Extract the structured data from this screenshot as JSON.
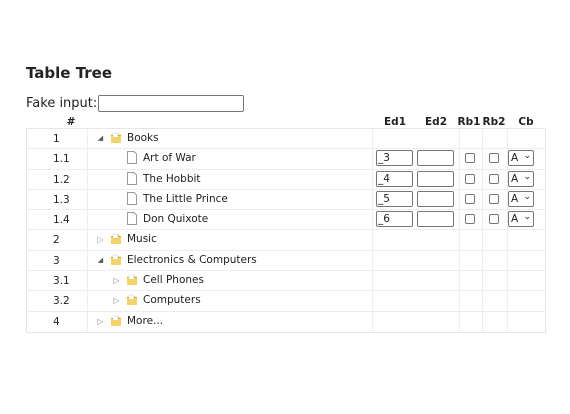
{
  "page": {
    "title": "Table Tree",
    "fake_input_label": "Fake input:",
    "fake_input_value": ""
  },
  "columns": {
    "num": "#",
    "ed1": "Ed1",
    "ed2": "Ed2",
    "rb1": "Rb1",
    "rb2": "Rb2",
    "cb": "Cb"
  },
  "rows": [
    {
      "num": "1",
      "title": "Books",
      "kind": "folder",
      "state": "expanded",
      "level": 0
    },
    {
      "num": "1.1",
      "title": "Art of War",
      "kind": "doc",
      "level": 1,
      "ed1": "_3",
      "ed2": "",
      "cb": "A"
    },
    {
      "num": "1.2",
      "title": "The Hobbit",
      "kind": "doc",
      "level": 1,
      "ed1": "_4",
      "ed2": "",
      "cb": "A"
    },
    {
      "num": "1.3",
      "title": "The Little Prince",
      "kind": "doc",
      "level": 1,
      "ed1": "_5",
      "ed2": "",
      "cb": "A"
    },
    {
      "num": "1.4",
      "title": "Don Quixote",
      "kind": "doc",
      "level": 1,
      "ed1": "_6",
      "ed2": "",
      "cb": "A"
    },
    {
      "num": "2",
      "title": "Music",
      "kind": "folder",
      "state": "collapsed",
      "level": 0
    },
    {
      "num": "3",
      "title": "Electronics & Computers",
      "kind": "folder",
      "state": "expanded",
      "level": 0
    },
    {
      "num": "3.1",
      "title": "Cell Phones",
      "kind": "folder",
      "state": "collapsed",
      "level": 1
    },
    {
      "num": "3.2",
      "title": "Computers",
      "kind": "folder",
      "state": "collapsed",
      "level": 1
    },
    {
      "num": "4",
      "title": "More...",
      "kind": "folder",
      "state": "collapsed",
      "level": 0
    }
  ],
  "icons": {
    "expanded": "expanded-triangle-icon",
    "collapsed": "collapsed-triangle-icon",
    "folder": "folder-icon",
    "doc": "document-icon"
  },
  "colors": {
    "folder_fill": "#f3d36b",
    "folder_edge": "#d4a82a",
    "grid_line": "#ededed"
  }
}
